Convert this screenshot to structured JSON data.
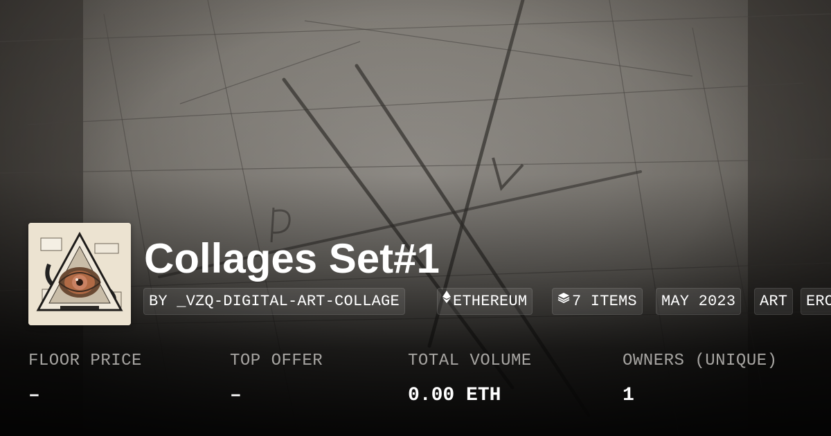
{
  "collection": {
    "title": "Collages Set#1",
    "thumbnail_icon": "eye-triangle-collage-image"
  },
  "chips": {
    "creator": "BY _VZQ-DIGITAL-ART-COLLAGE",
    "chain": "ETHEREUM",
    "chain_icon": "ethereum-icon",
    "items": "7 ITEMS",
    "items_icon": "layers-icon",
    "date": "MAY 2023",
    "category": "ART",
    "standard": "ERC"
  },
  "stats": {
    "floor_price": {
      "label": "FLOOR PRICE",
      "value": "–"
    },
    "top_offer": {
      "label": "TOP OFFER",
      "value": "–"
    },
    "total_volume": {
      "label": "TOTAL VOLUME",
      "value": "0.00 ETH"
    },
    "owners": {
      "label": "OWNERS (UNIQUE)",
      "value": "1"
    }
  },
  "colors": {
    "text_primary": "#ffffff",
    "text_secondary": "#a7a5a2",
    "chip_bg": "rgba(255,255,255,0.09)"
  }
}
